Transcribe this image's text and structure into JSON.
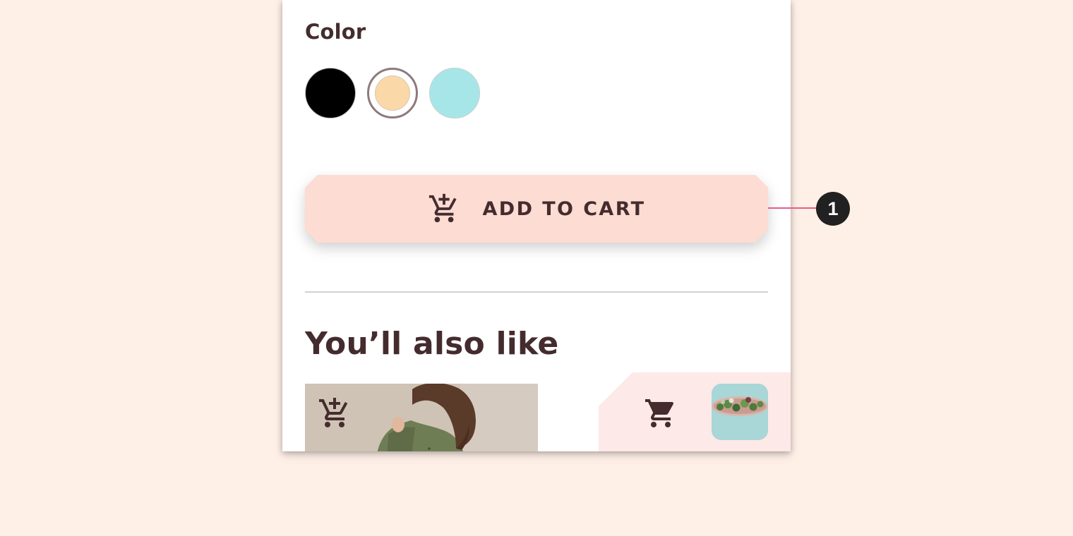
{
  "product": {
    "color_label": "Color",
    "color_options": [
      {
        "name": "black",
        "hex": "#000000",
        "selected": false
      },
      {
        "name": "peach",
        "hex": "#fad8a8",
        "selected": true
      },
      {
        "name": "aqua",
        "hex": "#a7e6e8",
        "selected": false
      }
    ],
    "add_to_cart": {
      "label": "ADD TO CART",
      "icon": "add-shopping-cart-icon"
    }
  },
  "recommendations": {
    "title": "You’ll also like",
    "items": [
      {
        "image": "woman-green-shirt-photo",
        "icon": "add-shopping-cart-icon"
      }
    ]
  },
  "cart_sheet": {
    "icon": "shopping-cart-icon",
    "thumbnail": "succulent-planter-photo"
  },
  "annotation": {
    "number": "1",
    "line_color": "#e85b8f"
  },
  "colors": {
    "background": "#fef0e7",
    "surface": "#ffffff",
    "primary": "#fcdcd3",
    "on_primary": "#442c2e",
    "sheet": "#fde9e7"
  }
}
